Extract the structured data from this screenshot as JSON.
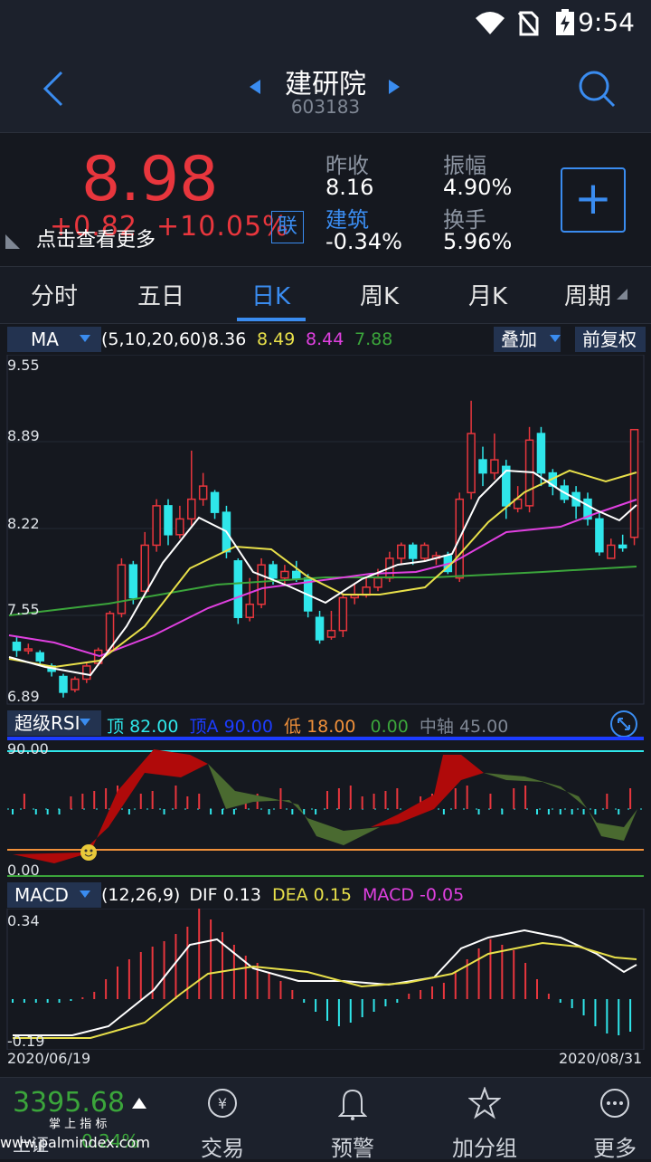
{
  "status": {
    "time": "9:54"
  },
  "header": {
    "title": "建研院",
    "code": "603183"
  },
  "quote": {
    "price": "8.98",
    "change": "+0.82",
    "change_pct": "+10.05%",
    "link_badge": "联",
    "tip": "点击查看更多",
    "prev_close_label": "昨收",
    "prev_close": "8.16",
    "amplitude_label": "振幅",
    "amplitude": "4.90%",
    "sector_label": "建筑",
    "sector": "-0.34%",
    "turnover_label": "换手",
    "turnover": "5.96%",
    "add_button": "+"
  },
  "tabs": [
    "分时",
    "五日",
    "日K",
    "周K",
    "月K",
    "周期"
  ],
  "active_tab": 2,
  "ma_bar": {
    "selector": "MA",
    "params": "(5,10,20,60)",
    "ma5": "8.36",
    "ma10": "8.49",
    "ma20": "8.44",
    "ma60": "7.88",
    "overlay": "叠加",
    "adjust": "前复权"
  },
  "kline_axis": {
    "labels": [
      "9.55",
      "8.89",
      "8.22",
      "7.55",
      "6.89"
    ]
  },
  "rsi_bar": {
    "selector": "超级RSI",
    "top_label": "顶",
    "top": "82.00",
    "topa_label": "顶A",
    "topa": "90.00",
    "low_label": "低",
    "low": "18.00",
    "zero": "0.00",
    "mid_label": "中轴",
    "mid": "45.00"
  },
  "rsi_axis": {
    "top": "90.00",
    "bottom": "0.00"
  },
  "macd_bar": {
    "selector": "MACD",
    "params": "(12,26,9)",
    "dif_label": "DIF",
    "dif": "0.13",
    "dea_label": "DEA",
    "dea": "0.15",
    "macd_label": "MACD",
    "macd": "-0.05"
  },
  "macd_axis": {
    "top": "0.34",
    "bottom": "-0.19"
  },
  "dates": {
    "start": "2020/06/19",
    "end": "2020/08/31"
  },
  "bottom": {
    "index_value": "3395.68",
    "index_name": "上证",
    "index_change": "0.24%",
    "watermark": "掌 上 指 标",
    "watermark2": "www.palmindex.com",
    "nav": [
      "交易",
      "预警",
      "加分组",
      "更多"
    ]
  },
  "colors": {
    "up": "#e8363d",
    "down": "#2fe6ea",
    "accent": "#3a8cf0",
    "ma5": "#ffffff",
    "ma10": "#e8e04a",
    "ma20": "#e040e0",
    "ma60": "#3ba53b"
  },
  "chart_data": {
    "type": "candlestick",
    "ylim": [
      6.89,
      9.55
    ],
    "candles": [
      [
        7.36,
        7.3,
        7.4,
        7.25
      ],
      [
        7.3,
        7.31,
        7.35,
        7.27
      ],
      [
        7.28,
        7.22,
        7.3,
        7.18
      ],
      [
        7.18,
        7.14,
        7.2,
        7.1
      ],
      [
        7.1,
        6.98,
        7.12,
        6.94
      ],
      [
        7.0,
        7.08,
        7.1,
        6.98
      ],
      [
        7.08,
        7.18,
        7.2,
        7.05
      ],
      [
        7.2,
        7.3,
        7.32,
        7.18
      ],
      [
        7.3,
        7.58,
        7.6,
        7.28
      ],
      [
        7.58,
        7.95,
        8.0,
        7.55
      ],
      [
        7.95,
        7.7,
        7.98,
        7.65
      ],
      [
        7.75,
        8.1,
        8.2,
        7.72
      ],
      [
        8.1,
        8.4,
        8.45,
        8.05
      ],
      [
        8.4,
        8.18,
        8.45,
        8.1
      ],
      [
        8.18,
        8.3,
        8.4,
        8.15
      ],
      [
        8.3,
        8.45,
        8.82,
        8.25
      ],
      [
        8.45,
        8.55,
        8.65,
        8.4
      ],
      [
        8.5,
        8.35,
        8.52,
        8.3
      ],
      [
        8.35,
        8.05,
        8.4,
        8.0
      ],
      [
        7.98,
        7.55,
        8.0,
        7.5
      ],
      [
        7.55,
        7.65,
        7.85,
        7.52
      ],
      [
        7.65,
        7.95,
        8.0,
        7.62
      ],
      [
        7.95,
        7.85,
        7.98,
        7.8
      ],
      [
        7.85,
        7.9,
        7.95,
        7.8
      ],
      [
        7.9,
        7.85,
        7.98,
        7.82
      ],
      [
        7.85,
        7.6,
        7.88,
        7.55
      ],
      [
        7.55,
        7.38,
        7.6,
        7.35
      ],
      [
        7.4,
        7.45,
        7.6,
        7.38
      ],
      [
        7.45,
        7.7,
        7.72,
        7.4
      ],
      [
        7.7,
        7.72,
        7.8,
        7.65
      ],
      [
        7.72,
        7.78,
        7.85,
        7.7
      ],
      [
        7.78,
        7.85,
        7.92,
        7.75
      ],
      [
        7.85,
        8.0,
        8.05,
        7.82
      ],
      [
        8.0,
        8.1,
        8.12,
        7.95
      ],
      [
        8.1,
        8.0,
        8.12,
        7.95
      ],
      [
        8.0,
        8.1,
        8.12,
        7.98
      ],
      [
        8.0,
        8.02,
        8.05,
        7.95
      ],
      [
        8.02,
        7.9,
        8.05,
        7.88
      ],
      [
        7.85,
        8.45,
        8.5,
        7.82
      ],
      [
        8.5,
        8.95,
        9.2,
        8.45
      ],
      [
        8.75,
        8.65,
        8.85,
        8.55
      ],
      [
        8.65,
        8.75,
        8.95,
        8.6
      ],
      [
        8.7,
        8.4,
        8.75,
        8.3
      ],
      [
        8.38,
        8.45,
        8.55,
        8.35
      ],
      [
        8.4,
        8.9,
        9.0,
        8.35
      ],
      [
        8.95,
        8.65,
        9.0,
        8.55
      ],
      [
        8.65,
        8.55,
        8.68,
        8.48
      ],
      [
        8.55,
        8.45,
        8.6,
        8.42
      ],
      [
        8.5,
        8.4,
        8.55,
        8.3
      ],
      [
        8.45,
        8.3,
        8.5,
        8.25
      ],
      [
        8.3,
        8.05,
        8.35,
        8.02
      ],
      [
        8.0,
        8.1,
        8.15,
        8.0
      ],
      [
        8.1,
        8.08,
        8.18,
        8.05
      ],
      [
        8.16,
        8.98,
        8.98,
        8.1
      ]
    ]
  }
}
